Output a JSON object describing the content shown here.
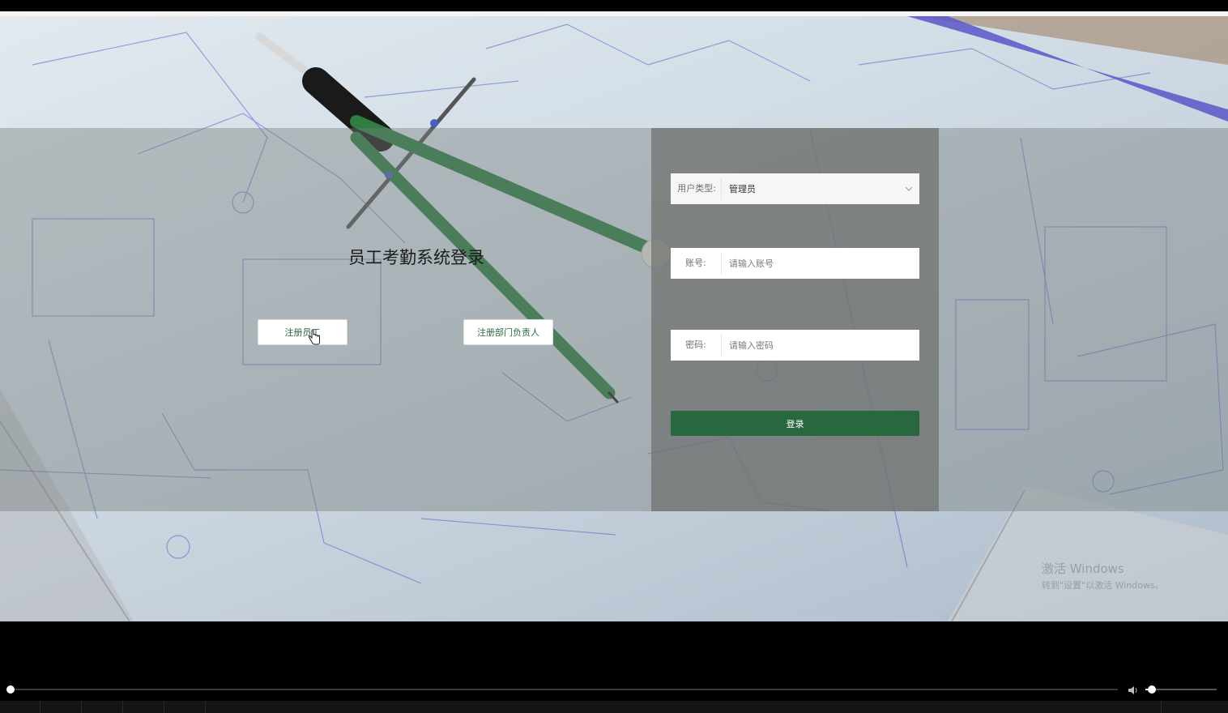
{
  "page": {
    "title": "员工考勤系统登录"
  },
  "register": {
    "employee_label": "注册员工",
    "manager_label": "注册部门负责人"
  },
  "form": {
    "user_type_label": "用户类型:",
    "user_type_value": "管理员",
    "account_label": "账号:",
    "account_placeholder": "请输入账号",
    "account_value": "",
    "password_label": "密码:",
    "password_placeholder": "请输入密码",
    "password_value": "",
    "login_label": "登录"
  },
  "watermark": {
    "line1": "激活 Windows",
    "line2": "转到\"设置\"以激活 Windows。"
  },
  "player": {
    "seek_progress": 0.0,
    "volume_level": 0.08
  },
  "colors": {
    "primary_green": "#27683f",
    "register_text": "#2d6b3f",
    "panel_overlay": "#6e706e"
  },
  "icons": {
    "select_arrow": "chevron-down-icon",
    "cursor": "hand-pointer-icon",
    "volume": "speaker-icon"
  }
}
